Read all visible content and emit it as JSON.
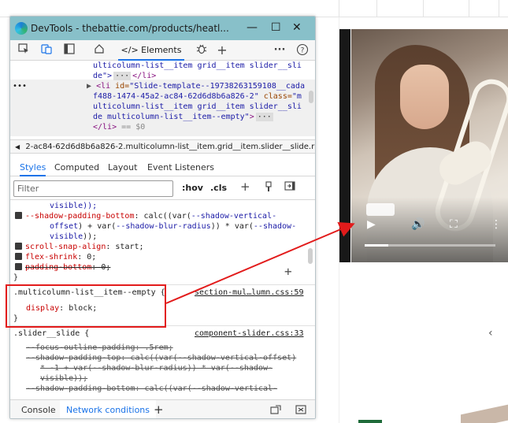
{
  "colors": {
    "titlebar": "#88c0c9",
    "accent": "#1a73e8",
    "annotation": "#e21b1b",
    "css_property": "#c80000",
    "css_var": "#1a1aa6",
    "html_tag": "#881280"
  },
  "window": {
    "title": "DevTools - thebattie.com/products/heatl...",
    "minimize": "—",
    "maximize": "☐",
    "close": "✕"
  },
  "toolbar": {
    "inspect_icon": "inspect-icon",
    "device_icon": "device-toggle-icon",
    "panel_icon": "dock-panel-icon",
    "welcome_icon": "home-icon",
    "elements_tab": "</> Elements",
    "sources_icon": "bug-icon",
    "more_tabs": "+",
    "more_menu": "···",
    "help": "?"
  },
  "dom": {
    "line1": "ulticolumn-list__item grid__item slider__sli",
    "line2_a": "de\">",
    "line2_b": "</li>",
    "line3_prefix": "▶",
    "line3_tag": "<li",
    "line3_attr": " id=",
    "line3_val": "\"Slide-template--19738263159108__cada",
    "line4_val": "f488-1474-45a2-ac84-62d6d8b6a826-2\"",
    "line4_attr": " class=",
    "line4_val2": "\"m",
    "line5_val": "ulticolumn-list__item grid__item slider__sli",
    "line6_val": "de multicolumn-list__item--empty\"",
    "line6_tag": ">",
    "line7_tag": "</li>",
    "line7_dim": " == $0",
    "dots": "•••"
  },
  "breadcrumb": {
    "arrow": "◀",
    "text": "2-ac84-62d6d8b6a826-2.multicolumn-list__item.grid__item.slider__slide.r"
  },
  "subtabs": [
    "Styles",
    "Computed",
    "Layout",
    "Event Listeners"
  ],
  "filter": {
    "placeholder": "Filter",
    "hov": ":hov",
    "cls": ".cls",
    "new_rule": "+"
  },
  "styles": {
    "r1_l0": "visible));",
    "r1_l1_prop": "--shadow-padding-bottom",
    "r1_l1_val_a": ": calc((var(",
    "r1_l1_var1": "--shadow-vertical-",
    "r1_l2_var": "offset",
    "r1_l2_val": ") + var(",
    "r1_l2_var2": "--shadow-blur-radius",
    "r1_l2_val2": ")) * var(",
    "r1_l2_var3": "--shadow-",
    "r1_l3_var": "visible",
    "r1_l3_val": "));",
    "r1_l4_prop": "scroll-snap-align",
    "r1_l4_val": ": start;",
    "r1_l5_prop": "flex-shrink",
    "r1_l5_val": ": 0;",
    "r1_l6_prop": "padding-bottom",
    "r1_l6_val": ": 0;",
    "close_brace": "}",
    "r2_selector": ".multicolumn-list__item--empty {",
    "r2_src": "section-mul…lumn.css:59",
    "r2_prop": "display",
    "r2_val": ": block;",
    "r3_selector": ".slider__slide {",
    "r3_src": "component-slider.css:33",
    "r3_l1": "--focus-outline-padding: .5rem;",
    "r3_l2": "--shadow-padding-top: calc((var(--shadow-vertical-offset)",
    "r3_l3": "* -1 + var(--shadow-blur-radius)) * var(--shadow-",
    "r3_l4": "visible));",
    "r3_l5": "--shadow-padding-bottom: calc((var(--shadow-vertical-"
  },
  "drawer": {
    "console": "Console",
    "network": "Network conditions",
    "add": "+"
  },
  "video": {
    "play": "▶",
    "volume": "🔊",
    "fullscreen": "⛶",
    "more": "⋮",
    "progress": 0.18
  },
  "page": {
    "chevron": "‹"
  }
}
